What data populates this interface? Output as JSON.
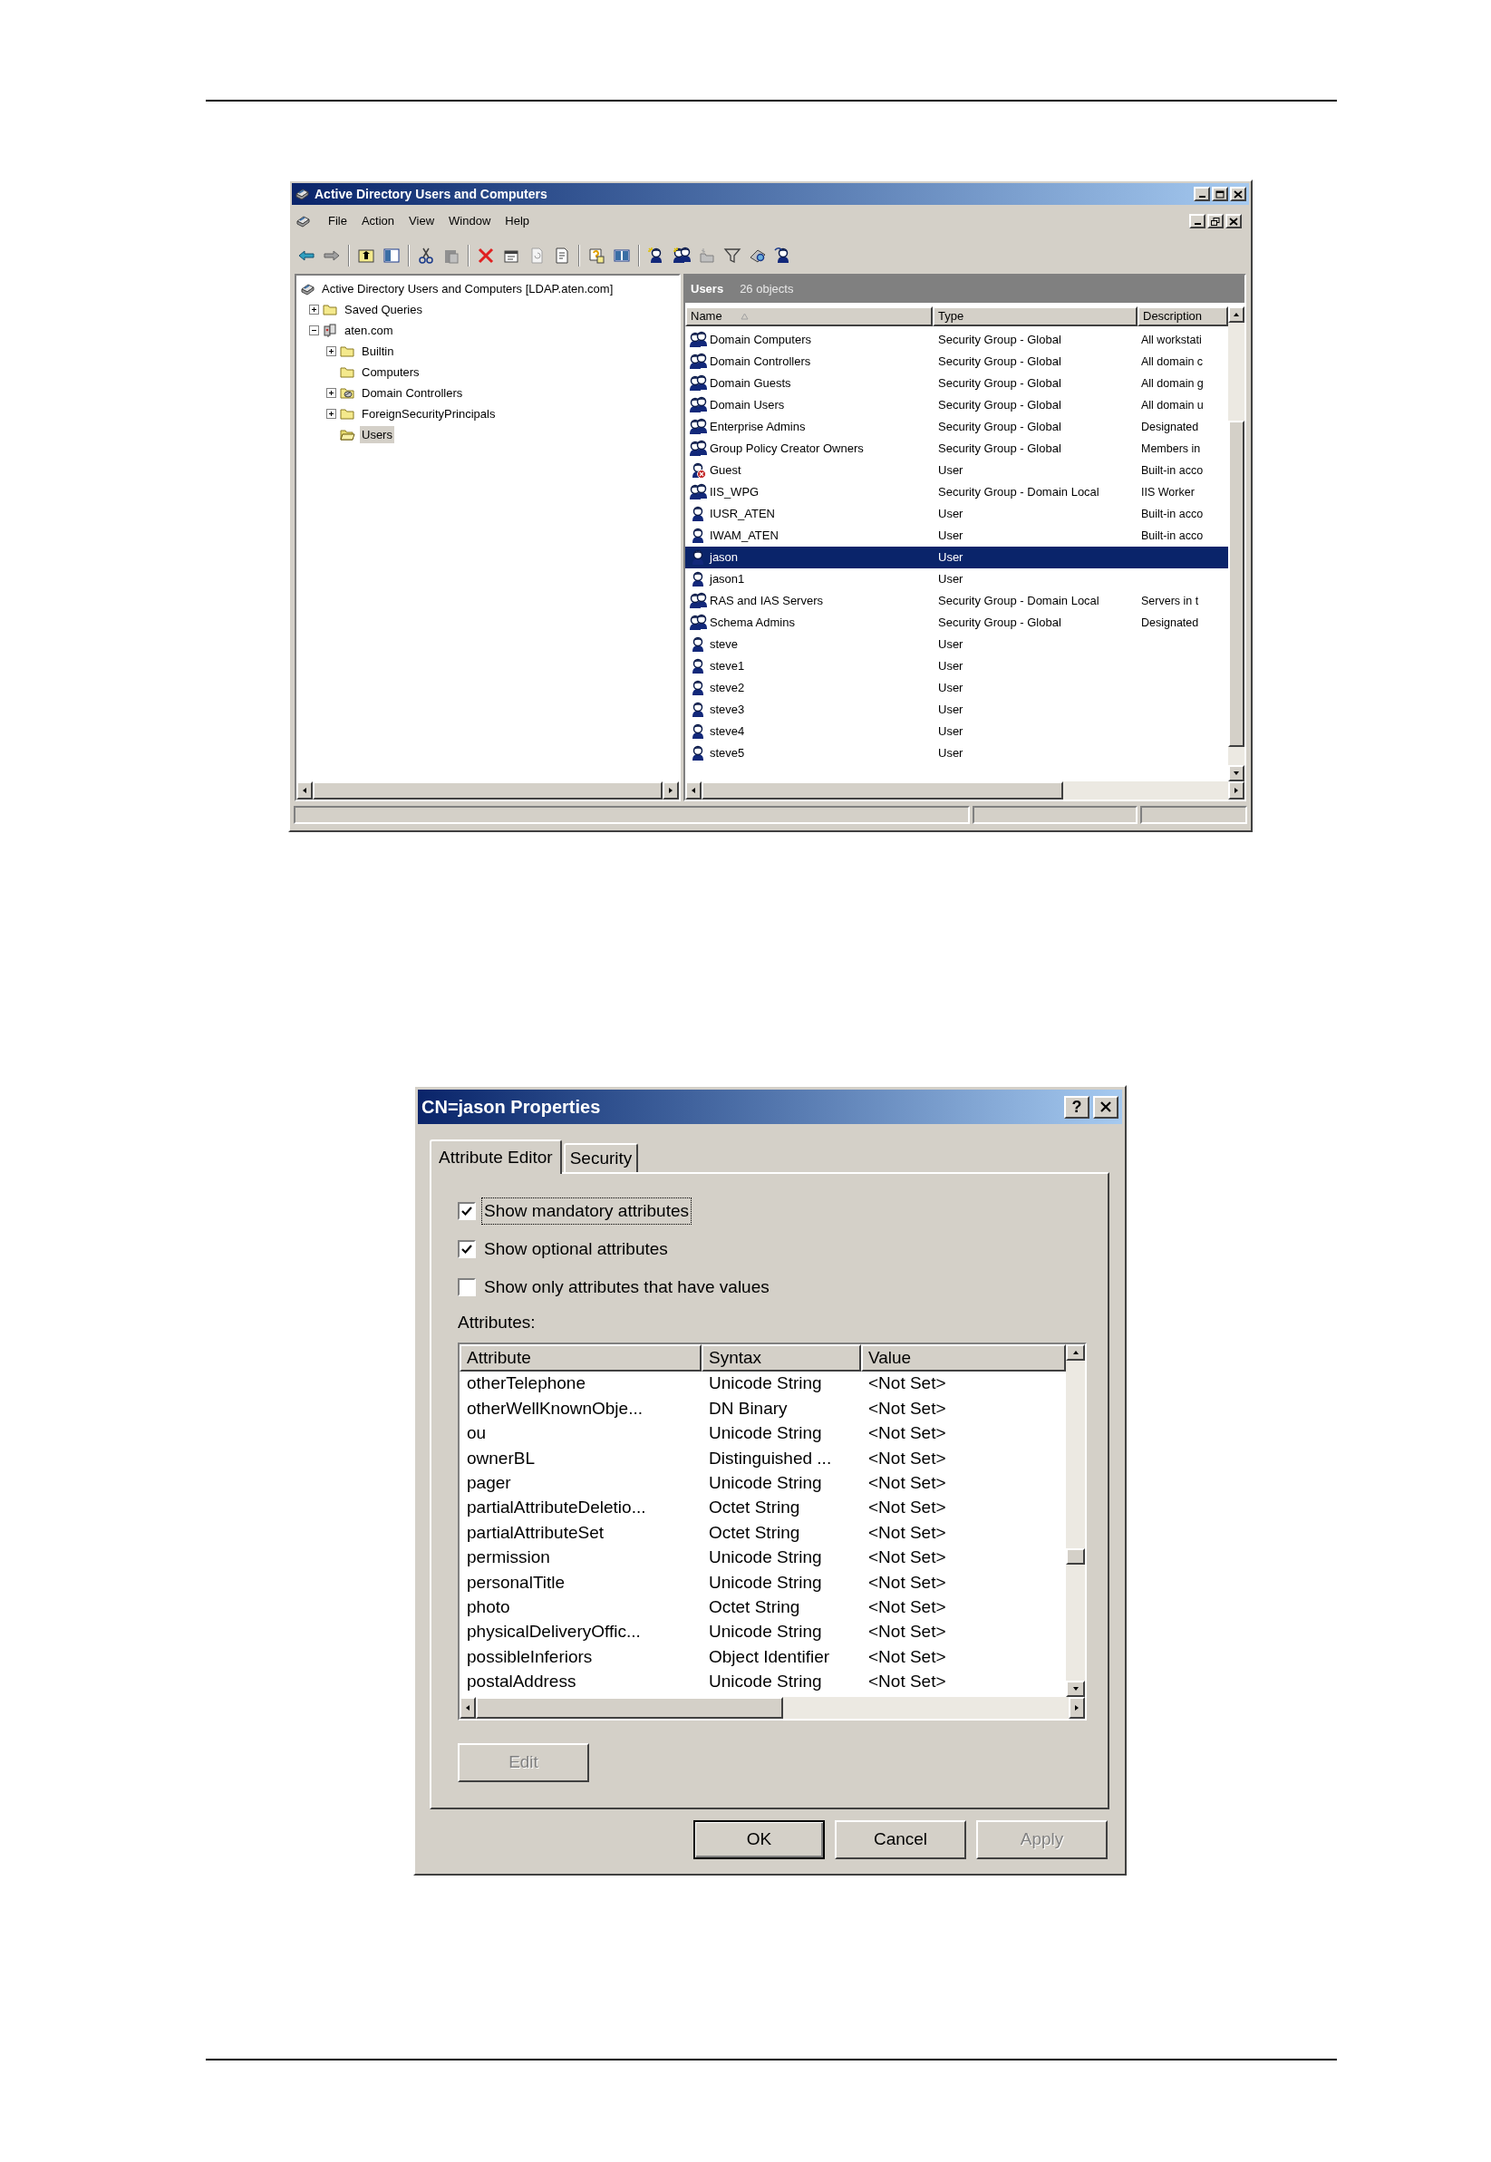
{
  "explorer": {
    "title": "Active Directory Users and Computers",
    "menu": [
      "File",
      "Action",
      "View",
      "Window",
      "Help"
    ],
    "tree": {
      "label": "Active Directory Users and Computers [LDAP.aten.com]",
      "kind": "snapin",
      "selected": false,
      "children": [
        {
          "label": "Saved Queries",
          "kind": "folder",
          "expanded": false,
          "selected": false
        },
        {
          "label": "aten.com",
          "kind": "domain",
          "expanded": true,
          "selected": false,
          "children": [
            {
              "label": "Builtin",
              "kind": "folder",
              "expanded": false,
              "selected": false
            },
            {
              "label": "Computers",
              "kind": "folder",
              "selected": false
            },
            {
              "label": "Domain Controllers",
              "kind": "ou",
              "expanded": false,
              "selected": false
            },
            {
              "label": "ForeignSecurityPrincipals",
              "kind": "folder",
              "expanded": false,
              "selected": false
            },
            {
              "label": "Users",
              "kind": "open-folder",
              "selected": true
            }
          ]
        }
      ]
    },
    "pane_title": "Users",
    "object_count": "26 objects",
    "columns": [
      "Name",
      "Type",
      "Description"
    ],
    "rows": [
      {
        "name": "Domain Computers",
        "type": "Security Group - Global",
        "description": "All workstati",
        "kind": "group",
        "selected": false
      },
      {
        "name": "Domain Controllers",
        "type": "Security Group - Global",
        "description": "All domain c",
        "kind": "group",
        "selected": false
      },
      {
        "name": "Domain Guests",
        "type": "Security Group - Global",
        "description": "All domain g",
        "kind": "group",
        "selected": false
      },
      {
        "name": "Domain Users",
        "type": "Security Group - Global",
        "description": "All domain u",
        "kind": "group",
        "selected": false
      },
      {
        "name": "Enterprise Admins",
        "type": "Security Group - Global",
        "description": "Designated",
        "kind": "group",
        "selected": false
      },
      {
        "name": "Group Policy Creator Owners",
        "type": "Security Group - Global",
        "description": "Members in",
        "kind": "group",
        "selected": false
      },
      {
        "name": "Guest",
        "type": "User",
        "description": "Built-in acco",
        "kind": "disabled-user",
        "selected": false
      },
      {
        "name": "IIS_WPG",
        "type": "Security Group - Domain Local",
        "description": "IIS Worker",
        "kind": "group",
        "selected": false
      },
      {
        "name": "IUSR_ATEN",
        "type": "User",
        "description": "Built-in acco",
        "kind": "user",
        "selected": false
      },
      {
        "name": "IWAM_ATEN",
        "type": "User",
        "description": "Built-in acco",
        "kind": "user",
        "selected": false
      },
      {
        "name": "jason",
        "type": "User",
        "kind": "user",
        "selected": true
      },
      {
        "name": "jason1",
        "type": "User",
        "kind": "user",
        "selected": false
      },
      {
        "name": "RAS and IAS Servers",
        "type": "Security Group - Domain Local",
        "description": "Servers in t",
        "kind": "group",
        "selected": false
      },
      {
        "name": "Schema Admins",
        "type": "Security Group - Global",
        "description": "Designated",
        "kind": "group",
        "selected": false
      },
      {
        "name": "steve",
        "type": "User",
        "kind": "user",
        "selected": false
      },
      {
        "name": "steve1",
        "type": "User",
        "kind": "user",
        "selected": false
      },
      {
        "name": "steve2",
        "type": "User",
        "kind": "user",
        "selected": false
      },
      {
        "name": "steve3",
        "type": "User",
        "kind": "user",
        "selected": false
      },
      {
        "name": "steve4",
        "type": "User",
        "kind": "user",
        "selected": false
      },
      {
        "name": "steve5",
        "type": "User",
        "kind": "user",
        "selected": false
      }
    ]
  },
  "dialog": {
    "title": "CN=jason Properties",
    "help_button": "?",
    "tabs": [
      {
        "label": "Attribute Editor",
        "selected": true
      },
      {
        "label": "Security",
        "selected": false
      }
    ],
    "checkboxes": [
      {
        "label": "Show mandatory attributes",
        "checked": true,
        "focused": true
      },
      {
        "label": "Show optional attributes",
        "checked": true,
        "focused": false
      },
      {
        "label": "Show only attributes that have values",
        "checked": false,
        "focused": false
      }
    ],
    "list_label": "Attributes:",
    "columns": [
      "Attribute",
      "Syntax",
      "Value"
    ],
    "rows": [
      {
        "attribute": "otherTelephone",
        "syntax": "Unicode String",
        "value": "<Not Set>"
      },
      {
        "attribute": "otherWellKnownObje...",
        "syntax": "DN Binary",
        "value": "<Not Set>"
      },
      {
        "attribute": "ou",
        "syntax": "Unicode String",
        "value": "<Not Set>"
      },
      {
        "attribute": "ownerBL",
        "syntax": "Distinguished ...",
        "value": "<Not Set>"
      },
      {
        "attribute": "pager",
        "syntax": "Unicode String",
        "value": "<Not Set>"
      },
      {
        "attribute": "partialAttributeDeletio...",
        "syntax": "Octet String",
        "value": "<Not Set>"
      },
      {
        "attribute": "partialAttributeSet",
        "syntax": "Octet String",
        "value": "<Not Set>"
      },
      {
        "attribute": "permission",
        "syntax": "Unicode String",
        "value": "<Not Set>"
      },
      {
        "attribute": "personalTitle",
        "syntax": "Unicode String",
        "value": "<Not Set>"
      },
      {
        "attribute": "photo",
        "syntax": "Octet String",
        "value": "<Not Set>"
      },
      {
        "attribute": "physicalDeliveryOffic...",
        "syntax": "Unicode String",
        "value": "<Not Set>"
      },
      {
        "attribute": "possibleInferiors",
        "syntax": "Object Identifier",
        "value": "<Not Set>"
      },
      {
        "attribute": "postalAddress",
        "syntax": "Unicode String",
        "value": "<Not Set>"
      }
    ],
    "edit_button": {
      "label": "Edit",
      "disabled": true
    },
    "buttons": [
      {
        "label": "OK",
        "default": true,
        "disabled": false
      },
      {
        "label": "Cancel",
        "default": false,
        "disabled": false
      },
      {
        "label": "Apply",
        "default": false,
        "disabled": true
      }
    ]
  }
}
